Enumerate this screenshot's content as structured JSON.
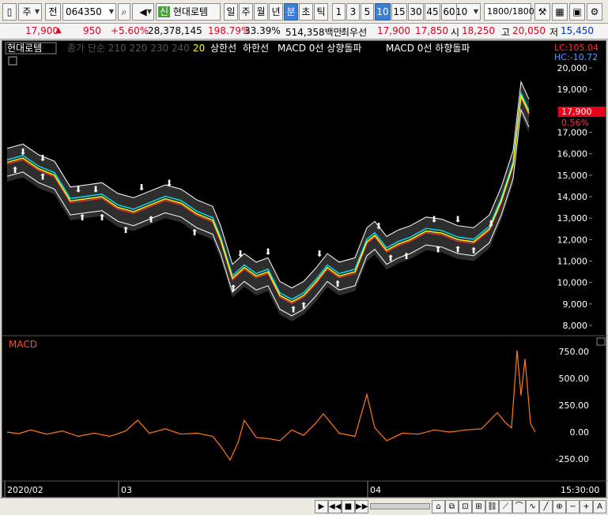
{
  "toolbar": {
    "type_label": "주",
    "code_prefix": "전",
    "stock_code": "064350",
    "stock_badge": "신",
    "stock_name": "현대로템",
    "period_tabs": [
      "일",
      "주",
      "월",
      "년",
      "분",
      "초",
      "틱"
    ],
    "period_selected": "분",
    "intervals": [
      "1",
      "3",
      "5",
      "10",
      "15",
      "30",
      "45",
      "60"
    ],
    "interval_selected": "10",
    "interval_select_value": "10",
    "count_value": "1800",
    "count_total": "/1800"
  },
  "price_bar": {
    "price": "17,900",
    "change": "950",
    "change_pct": "+5.60%",
    "volume": "28,378,145",
    "volume_ratio": "198.79%",
    "turnover_pct": "33.39%",
    "amount": "514,358백만",
    "best_ask_label": "최우선",
    "best_ask": "17,900",
    "best_bid": "17,850",
    "open_label": "시",
    "open": "18,250",
    "high_label": "고",
    "high": "20,050",
    "low_label": "저",
    "low": "15,450"
  },
  "legend": {
    "stock_name": "현대로템",
    "price_ma_label": "종가 단순 210 220 230 240",
    "ma20": "20",
    "upper_limit": "상한선",
    "lower_limit": "하한선",
    "macd_up": "MACD 0선 상향돌파",
    "macd_down": "MACD 0선 하향돌파"
  },
  "overlay": {
    "lc": "LC:105.04",
    "hc": "HC:-10.72",
    "current_price": "17,900",
    "current_pct": "0.56%"
  },
  "price_axis": [
    "20,000",
    "19,000",
    "18,000",
    "17,000",
    "16,000",
    "15,000",
    "14,000",
    "13,000",
    "12,000",
    "11,000",
    "10,000",
    "9,000",
    "8,000"
  ],
  "macd_title": "MACD",
  "macd_axis": [
    "750.00",
    "500.00",
    "250.00",
    "0.00",
    "-250.00"
  ],
  "time_axis": [
    "2020/02",
    "03",
    "04",
    "15:30:00"
  ],
  "colors": {
    "price_line": "#ffffff",
    "ma_yellow": "#ffff00",
    "ma_cyan": "#00e0ff",
    "ma_red": "#ff3030",
    "macd": "#ff7a10",
    "band": "#3a3a3a"
  }
}
